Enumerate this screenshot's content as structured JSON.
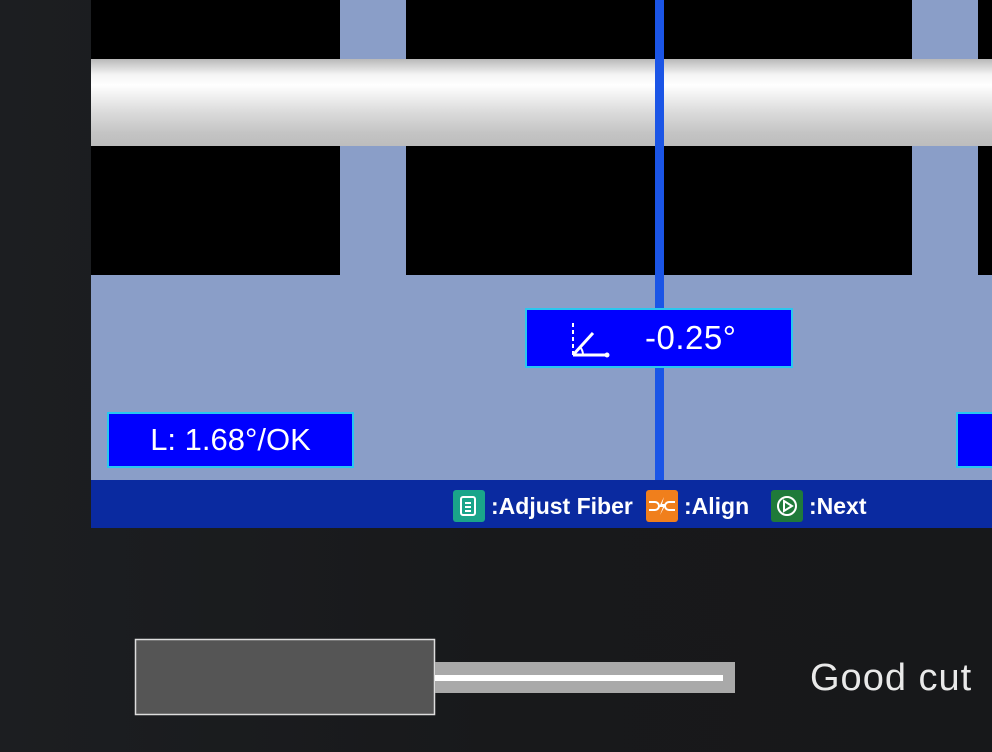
{
  "cleaver_screen": {
    "angle_readout": "-0.25°",
    "left_readout": "L: 1.68°/OK",
    "hints": [
      {
        "icon": "adjust-fiber-icon",
        "label": ":Adjust Fiber"
      },
      {
        "icon": "align-icon",
        "label": ":Align"
      },
      {
        "icon": "next-icon",
        "label": ":Next"
      }
    ]
  },
  "caption": "Good cut",
  "colors": {
    "screen_bg": "#8a9ec8",
    "readout_bg": "#0000ff",
    "readout_border": "#29c7f0",
    "center_line": "#1b55e6",
    "bottom_bar": "#0a2aa0",
    "adjust_icon_bg": "#1aa58a",
    "align_icon_bg": "#f07f1c",
    "next_icon_bg": "#1f7a3a"
  }
}
